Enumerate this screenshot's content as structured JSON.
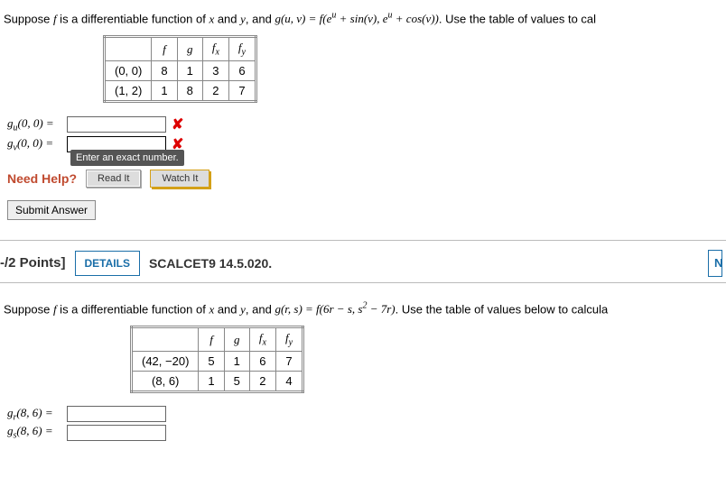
{
  "q1": {
    "prompt_prefix": "Suppose ",
    "prompt_f": "f",
    "prompt_mid1": " is a differentiable function of ",
    "prompt_x": "x",
    "prompt_and1": " and ",
    "prompt_y": "y",
    "prompt_mid2": ", and ",
    "prompt_g_expr": "g(u, v) = f(eᵘ + sin(v), eᵘ + cos(v))",
    "prompt_suffix": ". Use the table of values to cal",
    "table": {
      "headers": [
        "",
        "f",
        "g",
        "fₓ",
        "f_y"
      ],
      "rows": [
        {
          "pt": "(0, 0)",
          "f": "8",
          "g": "1",
          "fx": "3",
          "fy": "6"
        },
        {
          "pt": "(1, 2)",
          "f": "1",
          "g": "8",
          "fx": "2",
          "fy": "7"
        }
      ]
    },
    "answers": {
      "gu_label": "gᵤ(0, 0) = ",
      "gv_label": "gᵥ(0, 0) = ",
      "gu_value": "",
      "gv_value": ""
    },
    "tooltip": "Enter an exact number.",
    "need_help_label": "Need Help?",
    "read_it": "Read It",
    "watch_it": "Watch It",
    "submit": "Submit Answer"
  },
  "q2": {
    "header": {
      "points": "-/2 Points]",
      "details": "DETAILS",
      "ref": "SCALCET9 14.5.020.",
      "right": "N"
    },
    "prompt_prefix": "Suppose ",
    "prompt_f": "f",
    "prompt_mid1": " is a differentiable function of ",
    "prompt_x": "x",
    "prompt_and1": " and ",
    "prompt_y": "y",
    "prompt_mid2": ", and ",
    "prompt_g_expr": "g(r, s) = f(6r − s, s² − 7r)",
    "prompt_suffix": ". Use the table of values below to calcula",
    "table": {
      "headers": [
        "",
        "f",
        "g",
        "fₓ",
        "f_y"
      ],
      "rows": [
        {
          "pt": "(42, −20)",
          "f": "5",
          "g": "1",
          "fx": "6",
          "fy": "7"
        },
        {
          "pt": "(8, 6)",
          "f": "1",
          "g": "5",
          "fx": "2",
          "fy": "4"
        }
      ]
    },
    "answers": {
      "gr_label": "gᵣ(8, 6) = ",
      "gs_label": "gₛ(8, 6) = ",
      "gr_value": "",
      "gs_value": ""
    }
  }
}
